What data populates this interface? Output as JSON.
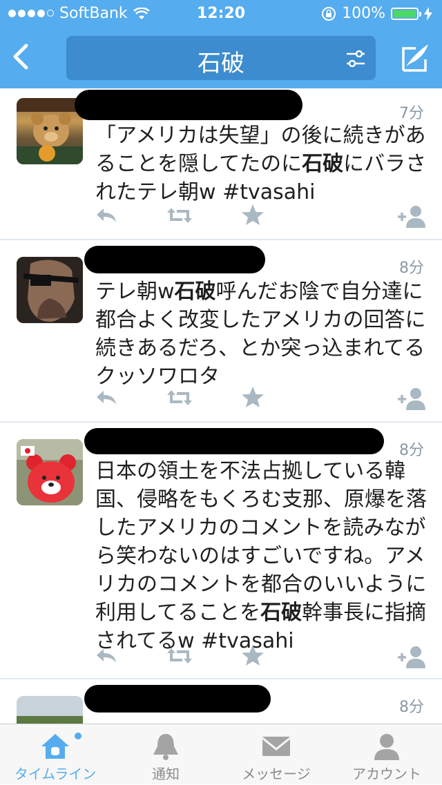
{
  "status_bar": {
    "carrier": "SoftBank",
    "time": "12:20",
    "battery": "100%",
    "battery_level": 1.0
  },
  "nav": {
    "title": "石破",
    "back_icon": "chevron-left-icon",
    "filter_icon": "filter-sliders-icon",
    "compose_icon": "compose-quill-icon"
  },
  "tweets": [
    {
      "time": "7分",
      "text_parts": [
        "「アメリカは失望」の後に続きがあることを隠してたのに",
        "石破",
        "にバラされたテレ朝w #tvasahi"
      ]
    },
    {
      "time": "8分",
      "text_parts": [
        "テレ朝w",
        "石破",
        "呼んだお陰で自分達に都合よく改変したアメリカの回答に続きあるだろ、とか突っ込まれてるクッソワロタ"
      ]
    },
    {
      "time": "8分",
      "text_parts": [
        "日本の領土を不法占拠している韓国、侵略をもくろむ支那、原爆を落したアメリカのコメントを読みながら笑わないのはすごいですね。アメリカのコメントを都合のいいように利用してることを",
        "石破",
        "幹事長に指摘されてるw #tvasahi"
      ]
    },
    {
      "time": "8分",
      "text_parts": []
    }
  ],
  "tabs": [
    {
      "label": "タイムライン",
      "icon": "home-icon",
      "active": true
    },
    {
      "label": "通知",
      "icon": "bell-icon",
      "active": false
    },
    {
      "label": "メッセージ",
      "icon": "envelope-icon",
      "active": false
    },
    {
      "label": "アカウント",
      "icon": "person-icon",
      "active": false
    }
  ],
  "colors": {
    "brand": "#55acee",
    "search_box": "#3d8ccf",
    "action_gray": "#aab8c2",
    "time_gray": "#8899a6"
  }
}
